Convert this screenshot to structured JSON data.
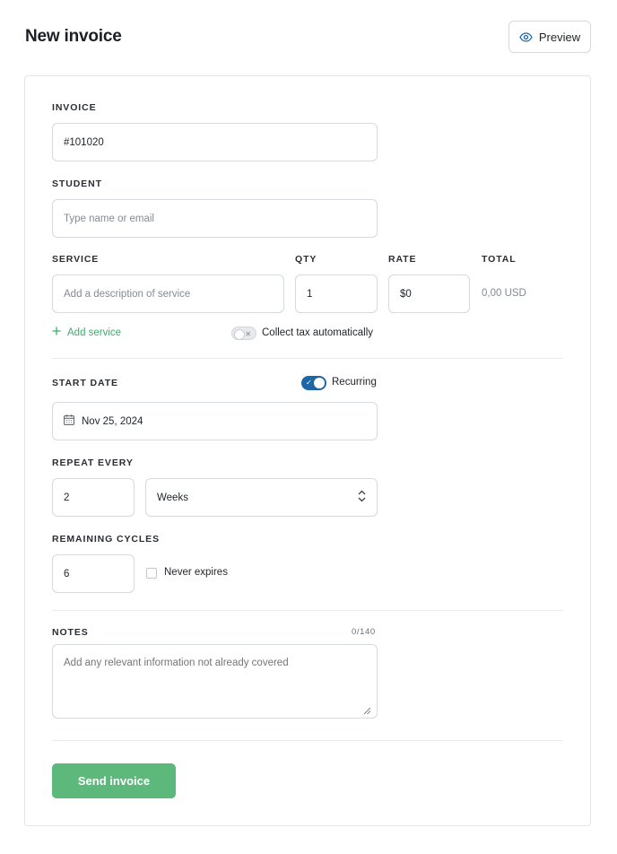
{
  "header": {
    "title": "New invoice",
    "preview_label": "Preview",
    "preview_icon": "eye-icon"
  },
  "invoice": {
    "label": "INVOICE",
    "value": "#101020"
  },
  "student": {
    "label": "STUDENT",
    "placeholder": "Type name or email"
  },
  "service": {
    "label": "SERVICE",
    "placeholder": "Add a description of service",
    "qty_label": "QTY",
    "qty_value": "1",
    "rate_label": "RATE",
    "rate_value": "$0",
    "total_label": "TOTAL",
    "total_value": "0,00 USD",
    "add_service_label": "Add service",
    "collect_tax_label": "Collect tax automatically",
    "collect_tax_on": false
  },
  "schedule": {
    "start_date_label": "START DATE",
    "start_date_value": "Nov 25, 2024",
    "recurring_label": "Recurring",
    "recurring_on": true,
    "repeat_label": "REPEAT EVERY",
    "repeat_count": "2",
    "repeat_unit": "Weeks",
    "cycles_label": "REMAINING CYCLES",
    "cycles_value": "6",
    "never_expires_label": "Never expires",
    "never_expires_checked": false
  },
  "notes": {
    "label": "NOTES",
    "counter": "0/140",
    "placeholder": "Add any relevant information not already covered"
  },
  "footer": {
    "send_label": "Send invoice"
  },
  "colors": {
    "accent_green": "#5cb87b",
    "link_green": "#3cae6d",
    "toggle_blue": "#1d67a6",
    "border": "#d6d9dd"
  }
}
